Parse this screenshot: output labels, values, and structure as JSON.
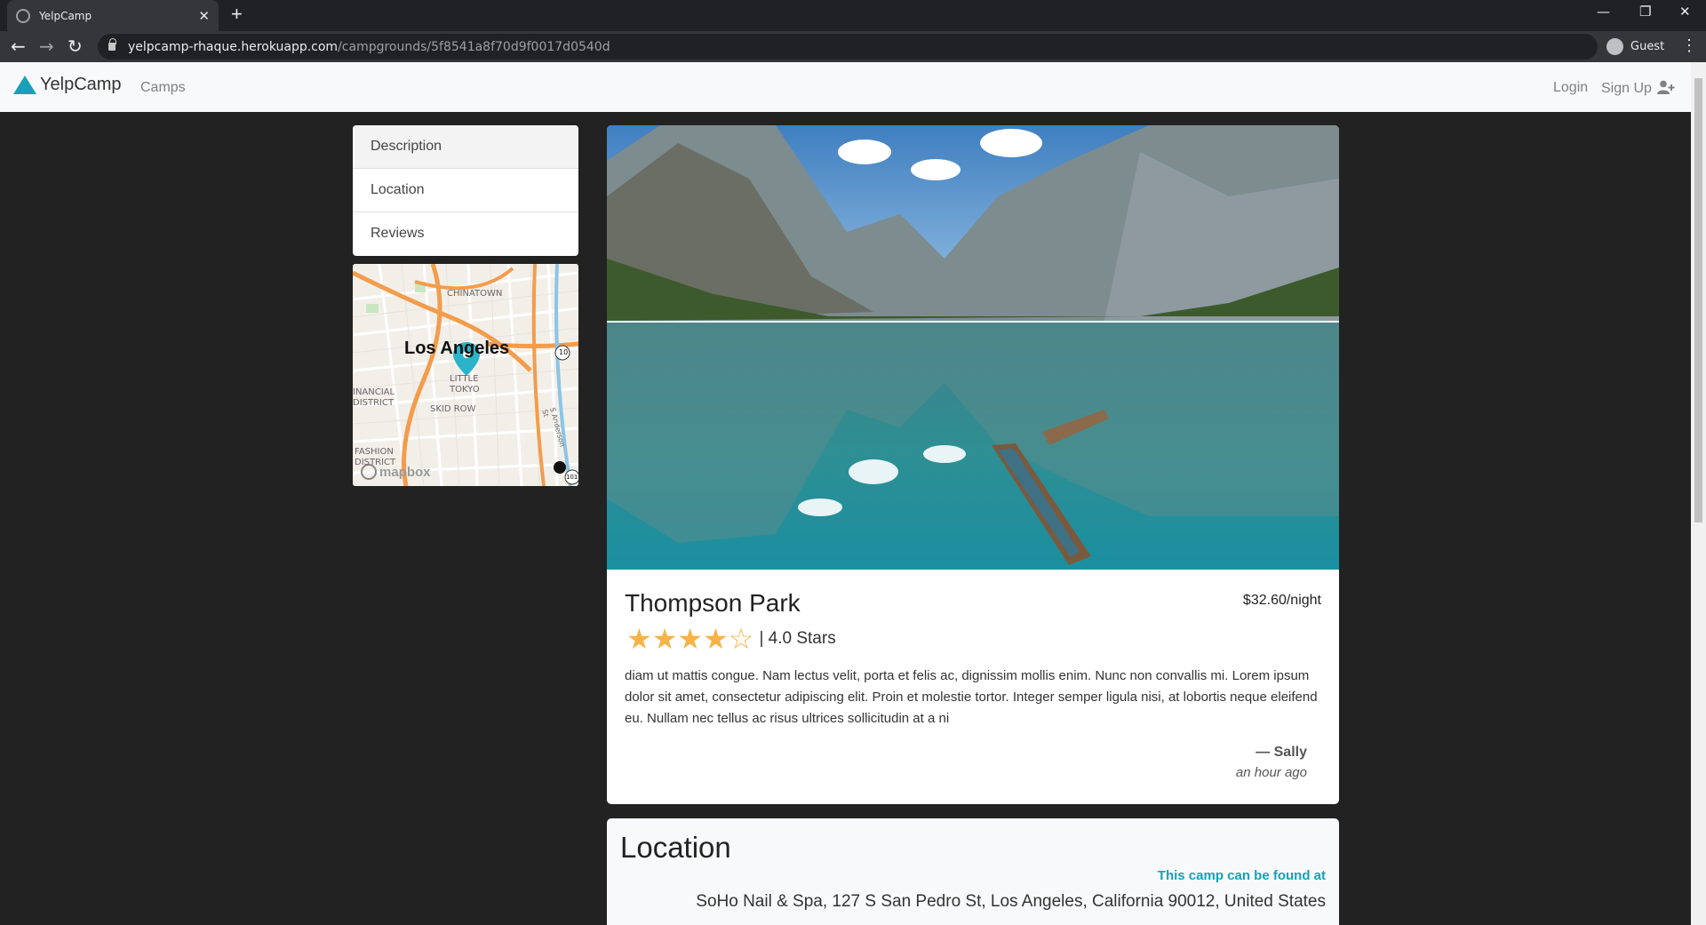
{
  "browser": {
    "tab_title": "YelpCamp",
    "tab_close": "✕",
    "new_tab": "+",
    "url_host": "yelpcamp-rhaque.herokuapp.com",
    "url_path": "/campgrounds/5f8541a8f70d9f0017d0540d",
    "profile": "Guest",
    "back": "←",
    "forward": "→",
    "reload": "↻",
    "minimize": "—",
    "restore": "❐",
    "close": "✕",
    "menu": "⋮"
  },
  "navbar": {
    "brand": "YelpCamp",
    "camps": "Camps",
    "login": "Login",
    "signup": "Sign Up"
  },
  "sidebar": {
    "items": [
      {
        "label": "Description"
      },
      {
        "label": "Location"
      },
      {
        "label": "Reviews"
      }
    ]
  },
  "map": {
    "city": "Los Angeles",
    "labels": {
      "chinatown": "CHINATOWN",
      "little_tokyo_1": "LITTLE",
      "little_tokyo_2": "TOKYO",
      "skid_row": "SKID ROW",
      "financial_1": "INANCIAL",
      "financial_2": "DISTRICT",
      "fashion_1": "FASHION",
      "fashion_2": "DISTRICT",
      "anderson": "S Anderson St",
      "hwy10": "10",
      "hwy101": "101",
      "mapbox": "mapbox"
    }
  },
  "campground": {
    "title": "Thompson Park",
    "price": "$32.60/night",
    "rating_stars": 4,
    "rating_text": "| 4.0 Stars",
    "review_body": "diam ut mattis congue. Nam lectus velit, porta et felis ac, dignissim mollis enim. Nunc non convallis mi. Lorem ipsum dolor sit amet, consectetur adipiscing elit. Proin et molestie tortor. Integer semper ligula nisi, at lobortis neque eleifend eu. Nullam nec tellus ac risus ultrices sollicitudin at a ni",
    "author": "— Sally",
    "time": "an hour ago"
  },
  "location": {
    "heading": "Location",
    "subheading": "This camp can be found at",
    "address": "SoHo Nail & Spa, 127 S San Pedro St, Los Angeles, California 90012, United States"
  },
  "colors": {
    "accent": "#17a2b8",
    "star": "#f7b344",
    "background": "#222222"
  }
}
